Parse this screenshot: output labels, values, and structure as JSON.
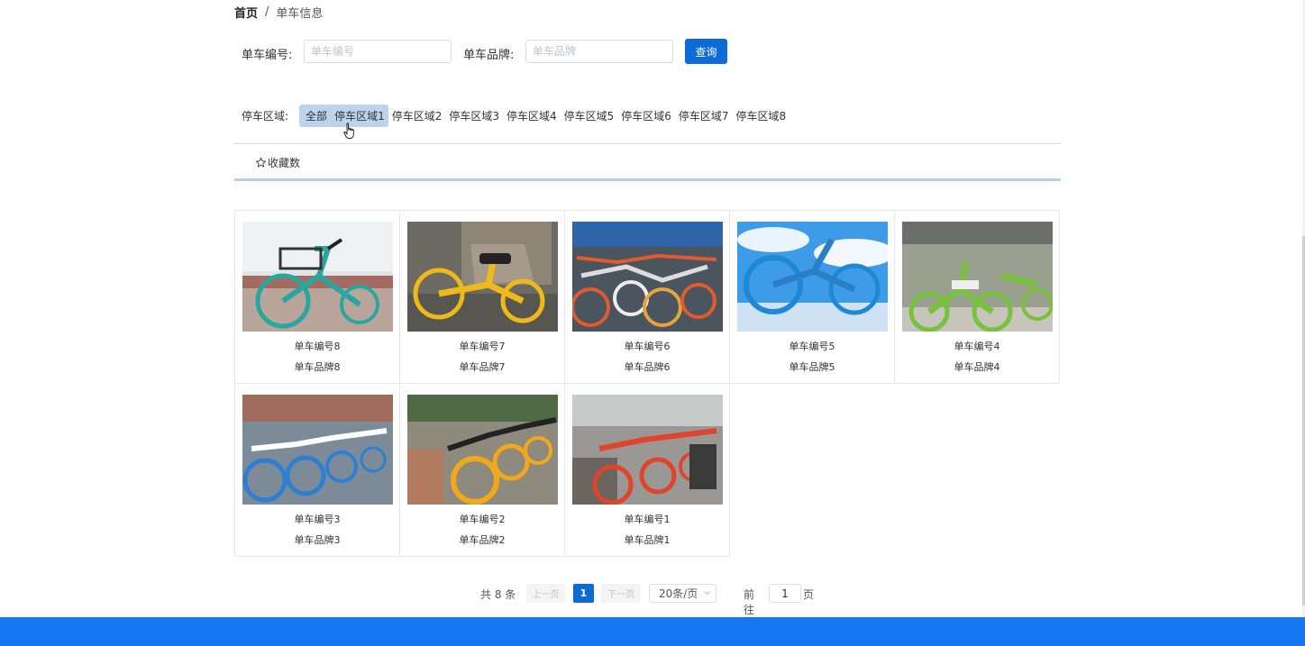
{
  "breadcrumb": {
    "home": "首页",
    "separator": "/",
    "current": "单车信息"
  },
  "search": {
    "number_label": "单车编号:",
    "number_placeholder": "单车编号",
    "number_value": "",
    "brand_label": "单车品牌:",
    "brand_placeholder": "单车品牌",
    "brand_value": "",
    "query_label": "查询"
  },
  "zones": {
    "label": "停车区域:",
    "items": [
      "全部",
      "停车区域1",
      "停车区域2",
      "停车区域3",
      "停车区域4",
      "停车区域5",
      "停车区域6",
      "停车区域7",
      "停车区域8"
    ],
    "selected": [
      "全部",
      "停车区域1"
    ]
  },
  "sort": {
    "favorites_label": "收藏数",
    "favorites_icon": "star-outline-icon"
  },
  "bikes": [
    {
      "name": "单车编号8",
      "brand": "单车品牌8",
      "photo": "teal-bicycle-photo"
    },
    {
      "name": "单车编号7",
      "brand": "单车品牌7",
      "photo": "yellow-bicycle-photo"
    },
    {
      "name": "单车编号6",
      "brand": "单车品牌6",
      "photo": "orange-bicycles-pile-photo"
    },
    {
      "name": "单车编号5",
      "brand": "单车品牌5",
      "photo": "blue-bicycle-sky-photo"
    },
    {
      "name": "单车编号4",
      "brand": "单车品牌4",
      "photo": "green-bicycles-photo"
    },
    {
      "name": "单车编号3",
      "brand": "单车品牌3",
      "photo": "blue-bicycles-row-photo"
    },
    {
      "name": "单车编号2",
      "brand": "单车品牌2",
      "photo": "yellow-bicycles-row-photo"
    },
    {
      "name": "单车编号1",
      "brand": "单车品牌1",
      "photo": "red-bicycles-row-photo"
    }
  ],
  "pagination": {
    "total_text": "共 8 条",
    "prev_label": "上一页",
    "current_page": "1",
    "next_label": "下一页",
    "page_size": "20条/页",
    "goto_label": "前往",
    "goto_value": "1",
    "page_suffix": "页"
  },
  "colors": {
    "primary": "#0d6bd6",
    "footer": "#1677f2",
    "selected_zone_bg": "#bcd3ee"
  }
}
